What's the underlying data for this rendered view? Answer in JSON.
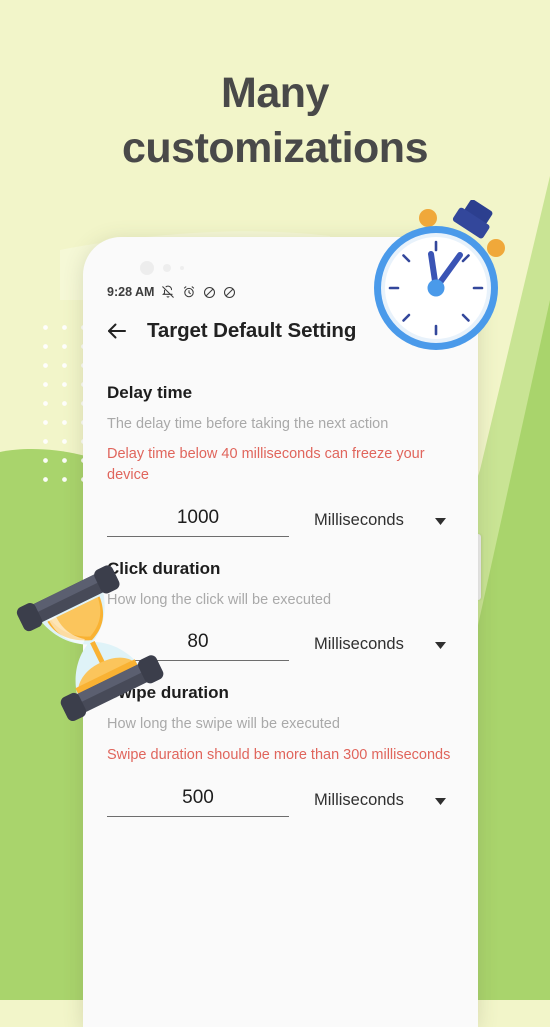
{
  "headline": {
    "line1": "Many",
    "line2": "customizations"
  },
  "colors": {
    "background": "#f2f5c9",
    "green_shape": "#a9d46c",
    "green_shape_light": "#c3e08b",
    "headline_text": "#494949",
    "warning_text": "#e0655c",
    "description_text": "#a9a9a9",
    "title_text": "#1d1d1d",
    "stopwatch_blue": "#4a9aea",
    "stopwatch_dark_blue": "#33479b",
    "stopwatch_orange": "#f0a83a",
    "hourglass_sand": "#f9b233",
    "hourglass_glass": "#d6f1f7",
    "hourglass_cap": "#474a58"
  },
  "phone": {
    "statusbar": {
      "time": "9:28 AM",
      "icons": [
        {
          "name": "bell-off-icon"
        },
        {
          "name": "alarm-clock-icon"
        },
        {
          "name": "do-not-disturb-icon"
        },
        {
          "name": "do-not-disturb-icon"
        }
      ]
    },
    "appbar": {
      "back_icon": "back-arrow-icon",
      "title": "Target Default Setting"
    },
    "sections": [
      {
        "key": "delay_time",
        "title": "Delay time",
        "description": "The delay time before taking the next action",
        "warning": "Delay time below 40 milliseconds can freeze your device",
        "value": "1000",
        "unit": "Milliseconds",
        "unit_caret": "chevron-down-icon"
      },
      {
        "key": "click_duration",
        "title": "Click duration",
        "description": "How long the click will be executed",
        "warning": "",
        "value": "80",
        "unit": "Milliseconds",
        "unit_caret": "chevron-down-icon"
      },
      {
        "key": "swipe_duration",
        "title": "Swipe duration",
        "description": "How long the swipe will be executed",
        "warning": "Swipe duration should be more than 300 milliseconds",
        "value": "500",
        "unit": "Milliseconds",
        "unit_caret": "chevron-down-icon"
      }
    ]
  },
  "decorations": {
    "stopwatch": "stopwatch-illustration",
    "hourglass": "hourglass-illustration",
    "dot_grid": "dot-grid-pattern"
  }
}
